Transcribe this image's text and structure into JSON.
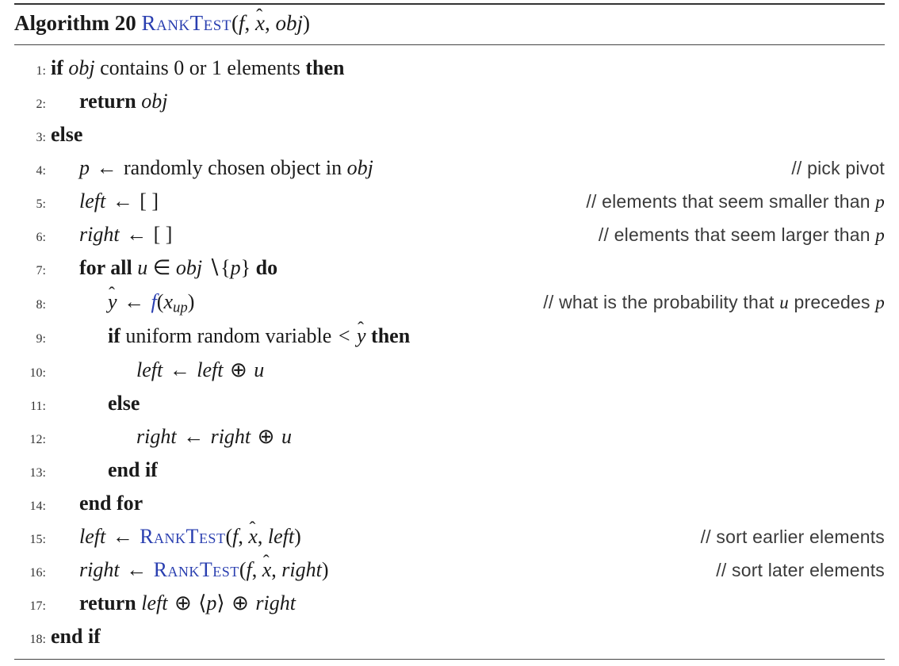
{
  "header": {
    "label": "Algorithm 20",
    "func": "RankTest",
    "args_open": "(",
    "arg_f": "f",
    "sep1": ", ",
    "arg_xhat": "x",
    "sep2": ", ",
    "arg_obj": "obj",
    "args_close": ")"
  },
  "lines": {
    "l1": {
      "n": "1:",
      "kw_if": "if",
      "obj": "obj",
      "txt": " contains 0 or 1 elements ",
      "kw_then": "then"
    },
    "l2": {
      "n": "2:",
      "kw_return": "return",
      "obj": "obj"
    },
    "l3": {
      "n": "3:",
      "kw_else": "else"
    },
    "l4": {
      "n": "4:",
      "p": "p",
      "arrow": " ← ",
      "txt": "randomly chosen object in ",
      "obj": "obj",
      "comment_pre": "// pick pivot"
    },
    "l5": {
      "n": "5:",
      "left": "left",
      "arrow": " ← ",
      "val": "[ ]",
      "comment_pre": "// elements that seem smaller than ",
      "comment_var": "p"
    },
    "l6": {
      "n": "6:",
      "right": "right",
      "arrow": " ← ",
      "val": "[ ]",
      "comment_pre": "// elements that seem larger than ",
      "comment_var": "p"
    },
    "l7": {
      "n": "7:",
      "kw_for": "for all",
      "u": "u",
      "in": " ∈ ",
      "obj": "obj",
      "set": " ∖{",
      "p": "p",
      "setc": "} ",
      "kw_do": "do"
    },
    "l8": {
      "n": "8:",
      "yhat": "y",
      "arrow": " ← ",
      "f": "f",
      "open": "(",
      "x": "x",
      "sub": "up",
      "close": ")",
      "comment_pre": "// what is the probability that ",
      "comment_u": "u",
      "comment_mid": " precedes ",
      "comment_p": "p"
    },
    "l9": {
      "n": "9:",
      "kw_if": "if",
      "txt": " uniform random variable ",
      "lt": "<",
      "yhat": "y",
      "kw_then": "then"
    },
    "l10": {
      "n": "10:",
      "left": "left",
      "arrow": " ← ",
      "left2": "left",
      "oplus": " ⊕ ",
      "u": "u"
    },
    "l11": {
      "n": "11:",
      "kw_else": "else"
    },
    "l12": {
      "n": "12:",
      "right": "right",
      "arrow": " ← ",
      "right2": "right",
      "oplus": " ⊕ ",
      "u": "u"
    },
    "l13": {
      "n": "13:",
      "kw_endif": "end if"
    },
    "l14": {
      "n": "14:",
      "kw_endfor": "end for"
    },
    "l15": {
      "n": "15:",
      "left": "left",
      "arrow": " ← ",
      "func": "RankTest",
      "open": "(",
      "f": "f",
      "s1": ", ",
      "xhat": "x",
      "s2": ", ",
      "arg3": "left",
      "close": ")",
      "comment": "// sort earlier elements"
    },
    "l16": {
      "n": "16:",
      "right": "right",
      "arrow": " ← ",
      "func": "RankTest",
      "open": "(",
      "f": "f",
      "s1": ", ",
      "xhat": "x",
      "s2": ", ",
      "arg3": "right",
      "close": ")",
      "comment": "// sort later elements"
    },
    "l17": {
      "n": "17:",
      "kw_return": "return",
      "sp": "  ",
      "left": "left",
      "oplus1": " ⊕ ",
      "ang_o": "⟨",
      "p": "p",
      "ang_c": "⟩",
      "oplus2": " ⊕ ",
      "right": "right"
    },
    "l18": {
      "n": "18:",
      "kw_endif": "end if"
    }
  }
}
